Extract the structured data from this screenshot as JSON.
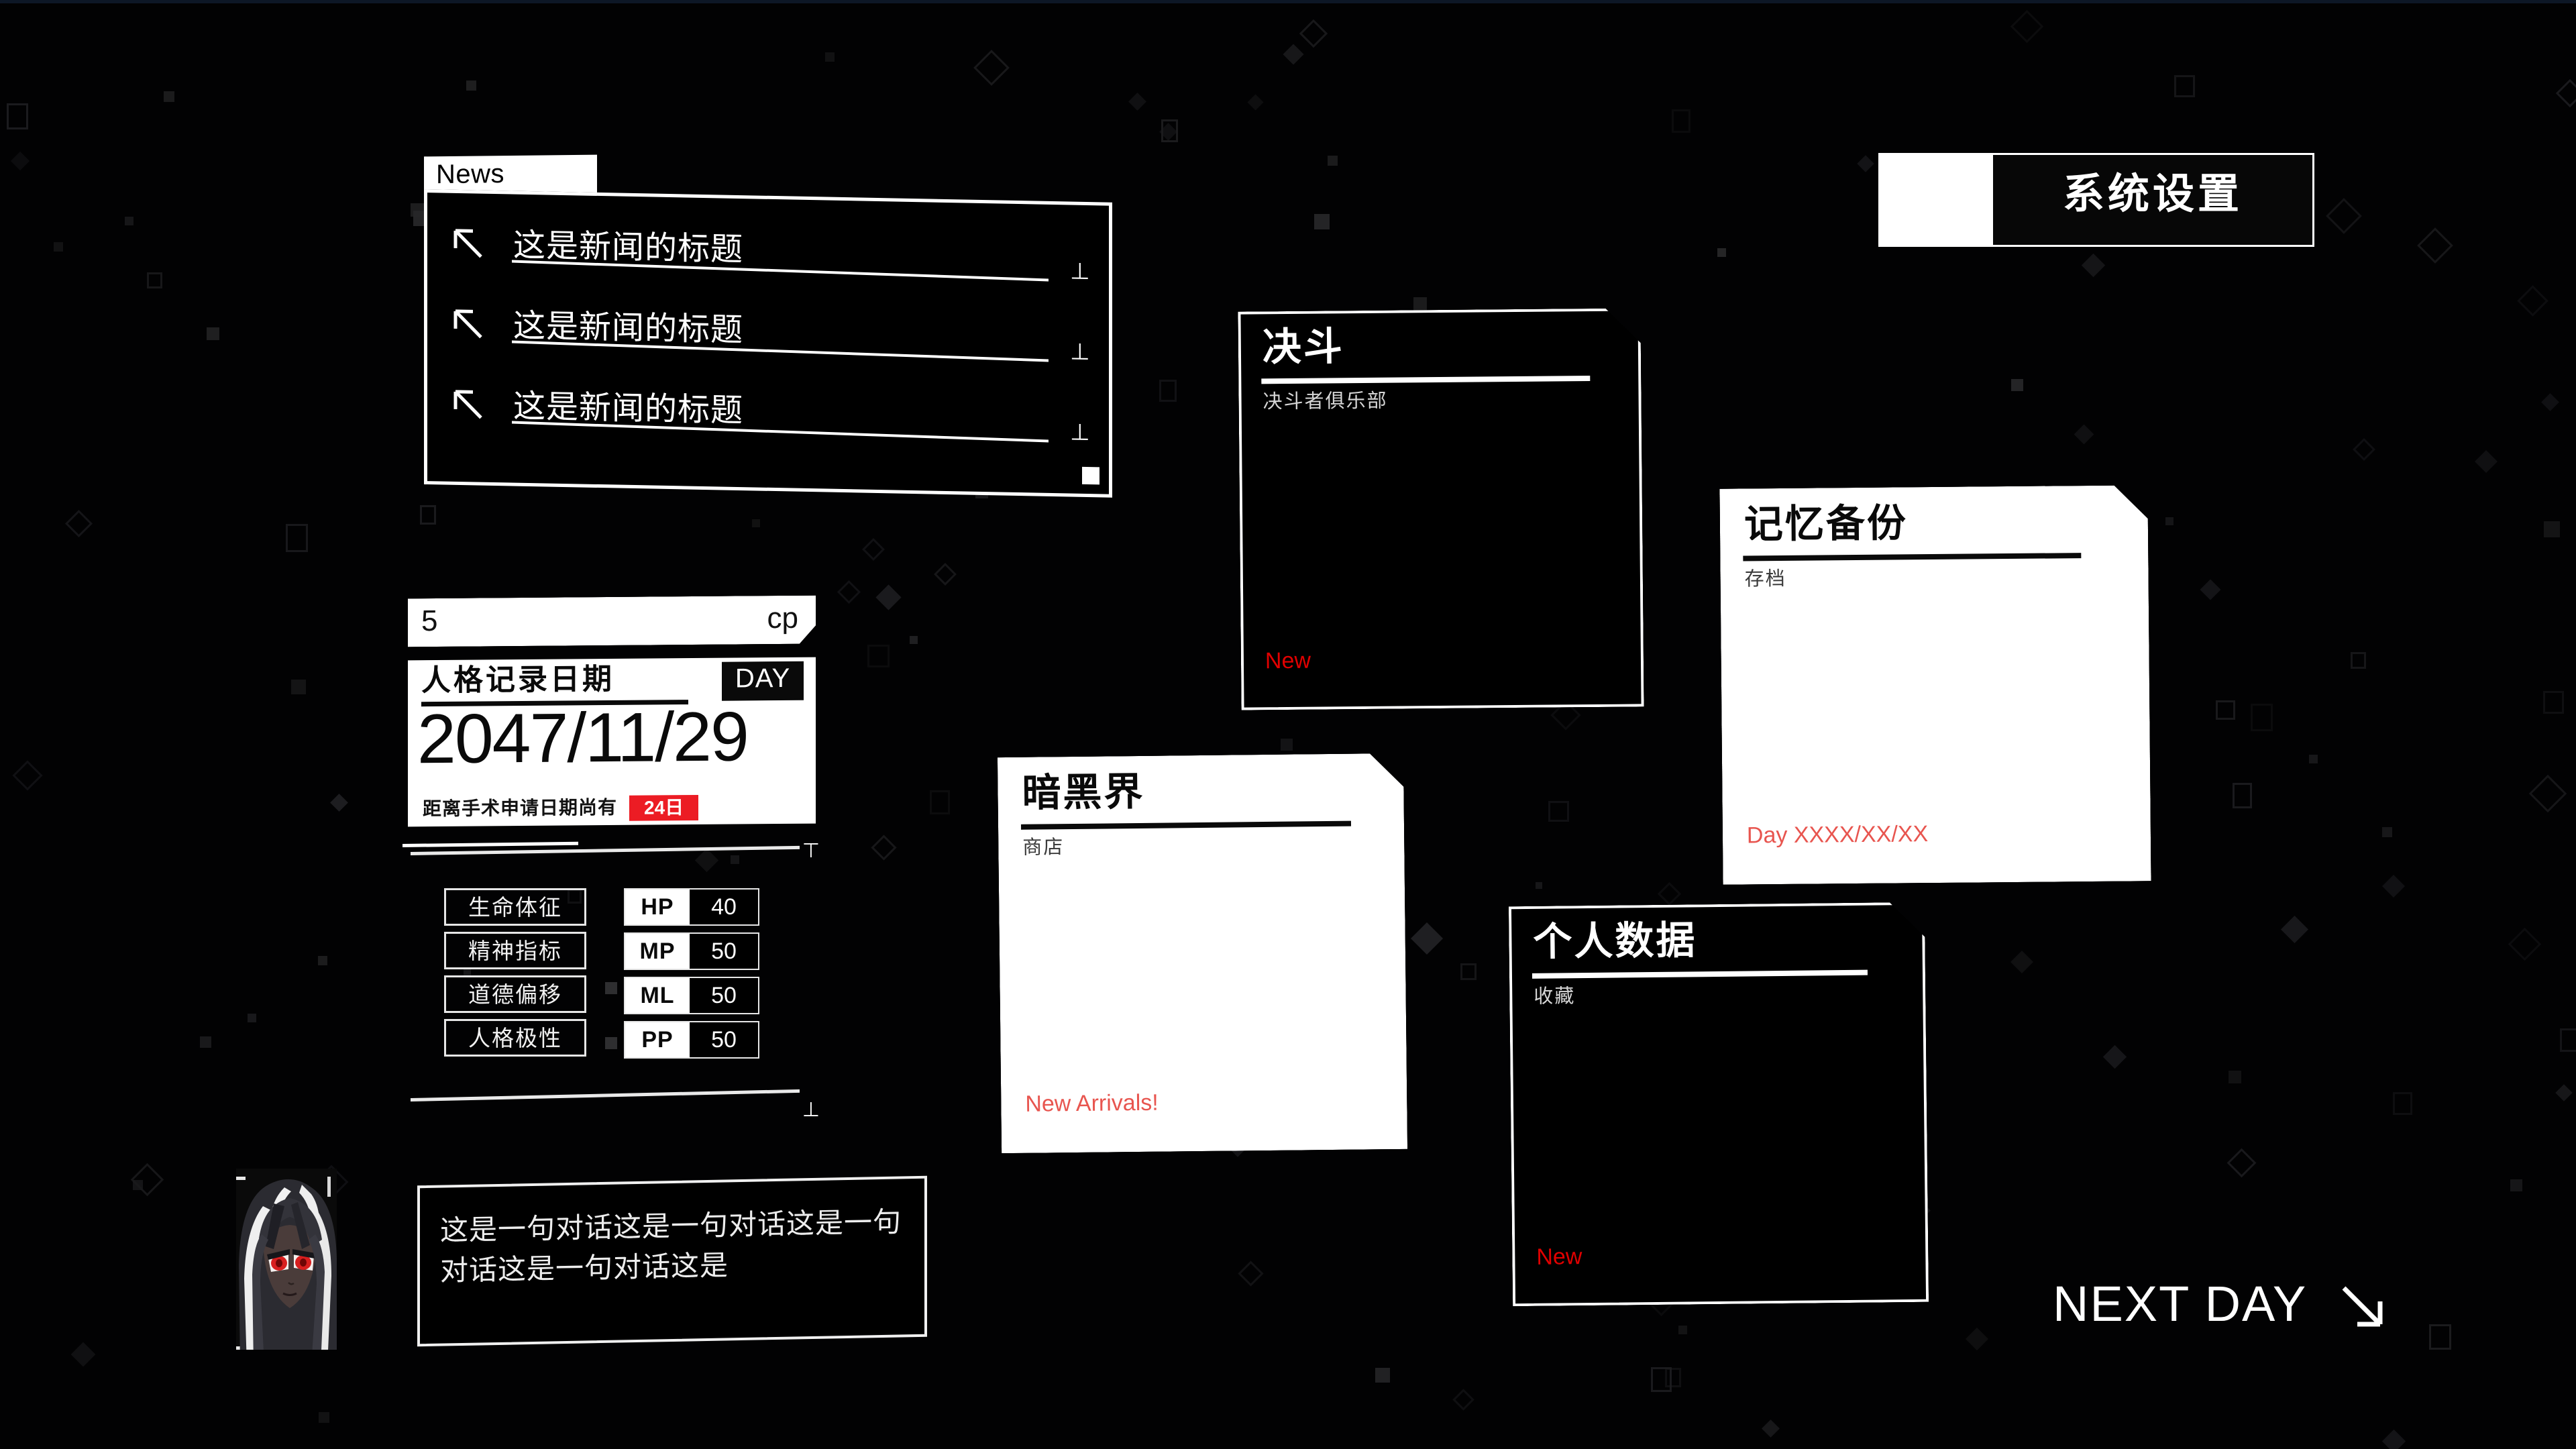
{
  "news": {
    "tab_label": "News",
    "items": [
      {
        "title": "这是新闻的标题",
        "end_mark": "⊥"
      },
      {
        "title": "这是新闻的标题",
        "end_mark": "⊥"
      },
      {
        "title": "这是新闻的标题",
        "end_mark": "⊥"
      }
    ],
    "arrow_icon": "arrow-up-left-icon"
  },
  "cp": {
    "value": "5",
    "unit": "cp"
  },
  "date_card": {
    "heading": "人格记录日期",
    "day_chip": "DAY",
    "date": "2047/11/29",
    "note": "距离手术申请日期尚有",
    "countdown": "24日"
  },
  "stats": {
    "names": [
      "生命体征",
      "精神指标",
      "道德偏移",
      "人格极性"
    ],
    "values": [
      {
        "key": "HP",
        "value": "40"
      },
      {
        "key": "MP",
        "value": "50"
      },
      {
        "key": "ML",
        "value": "50"
      },
      {
        "key": "PP",
        "value": "50"
      }
    ],
    "tick_mark": "⊤",
    "tick_mark_bottom": "⊥"
  },
  "cards": [
    {
      "id": "duel",
      "title": "决斗",
      "subtitle": "决斗者俱乐部",
      "badge": "New",
      "theme": "dark"
    },
    {
      "id": "shop",
      "title": "暗黑界",
      "subtitle": "商店",
      "badge": "New Arrivals!",
      "theme": "light"
    },
    {
      "id": "memory",
      "title": "记忆备份",
      "subtitle": "存档",
      "badge": "Day XXXX/XX/XX",
      "theme": "light"
    },
    {
      "id": "personal",
      "title": "个人数据",
      "subtitle": "收藏",
      "badge": "New",
      "theme": "dark"
    }
  ],
  "settings": {
    "label": "系统设置"
  },
  "dialogue": {
    "text": "这是一句对话这是一句对话这是一句对话这是一句对话这是",
    "avatar_name": "character-portrait"
  },
  "next_day": {
    "label": "NEXT DAY",
    "arrow_icon": "arrow-down-right-icon"
  },
  "colors": {
    "background": "#020203",
    "accent_white": "#ffffff",
    "red_on_dark": "#e00000",
    "red_on_light": "#e8554f",
    "chip_red": "#ec1c24"
  }
}
